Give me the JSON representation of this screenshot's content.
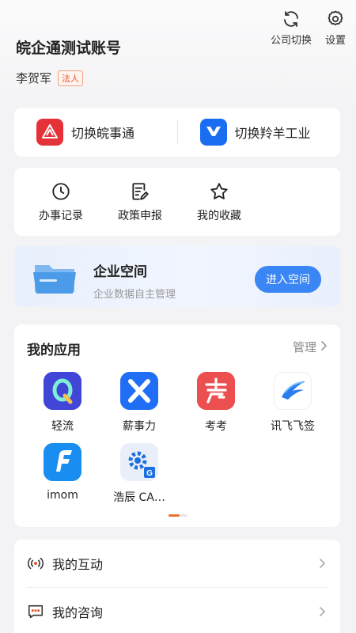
{
  "header": {
    "company_name": "皖企通测试账号",
    "user_name": "李贺军",
    "role_badge": "法人",
    "actions": [
      {
        "label": "公司切换",
        "icon": "refresh-icon"
      },
      {
        "label": "设置",
        "icon": "gear-icon"
      }
    ]
  },
  "switch": {
    "items": [
      {
        "label": "切换皖事通",
        "icon": "wanshitong-logo-icon",
        "color": "#e53238"
      },
      {
        "label": "切换羚羊工业",
        "icon": "lingyang-logo-icon",
        "color": "#1a6cf0"
      }
    ]
  },
  "quick": {
    "items": [
      {
        "label": "办事记录",
        "icon": "clock-icon"
      },
      {
        "label": "政策申报",
        "icon": "document-edit-icon"
      },
      {
        "label": "我的收藏",
        "icon": "star-icon"
      }
    ]
  },
  "space": {
    "title": "企业空间",
    "subtitle": "企业数据自主管理",
    "button": "进入空间"
  },
  "apps": {
    "title": "我的应用",
    "manage": "管理",
    "items": [
      {
        "label": "轻流",
        "icon": "qingliu-app-icon"
      },
      {
        "label": "薪事力",
        "icon": "xinshili-app-icon"
      },
      {
        "label": "考考",
        "icon": "kaokao-app-icon"
      },
      {
        "label": "讯飞飞签",
        "icon": "xunfei-feiqian-app-icon"
      },
      {
        "label": "imom",
        "icon": "imom-app-icon"
      },
      {
        "label": "浩辰 CA…",
        "icon": "haochen-cad-app-icon"
      }
    ]
  },
  "list": {
    "items": [
      {
        "label": "我的互动",
        "icon": "broadcast-icon"
      },
      {
        "label": "我的咨询",
        "icon": "chat-bubble-icon"
      }
    ]
  },
  "colors": {
    "accent_blue": "#3a86f4",
    "badge_orange": "#e8582a",
    "page_dot_active": "#ee6f32"
  }
}
